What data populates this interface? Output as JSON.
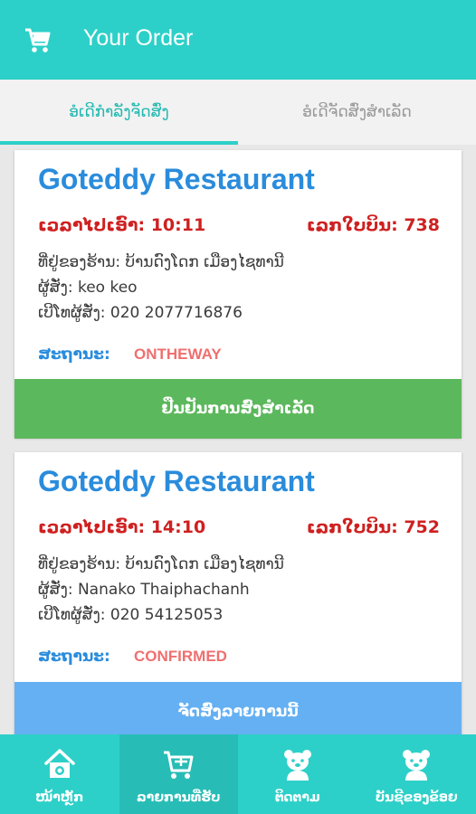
{
  "header": {
    "title": "Your Order",
    "icon": "cart-icon"
  },
  "tabs": [
    {
      "label": "ອໍເດີກຳລັງຈັດສົ່ງ",
      "active": true
    },
    {
      "label": "ອໍເດີຈັດສົ່ງສຳເລັດ",
      "active": false
    }
  ],
  "orders": [
    {
      "restaurant": "Goteddy Restaurant",
      "time": "ເວລາໄປເອົາ: 10:11",
      "bill": "ເລກໃບບິນ: 738",
      "address": "ທີ່ຢູ່ຂອງຮ້ານ: ບ້ານດົງໂດກ ເມືອງໄຊທານີ",
      "orderer": "ຜູ້ສັ່ງ: keo keo",
      "phone": "ເບີໂທຜູ້ສັ່ງ: 020 2077716876",
      "status_label": "ສະຖານະ:",
      "status": "ONTHEWAY",
      "action": "ຢືນຢັນການສົ່ງສຳເລັດ",
      "action_color": "#5cb85c"
    },
    {
      "restaurant": "Goteddy Restaurant",
      "time": "ເວລາໄປເອົາ: 14:10",
      "bill": "ເລກໃບບິນ: 752",
      "address": "ທີ່ຢູ່ຂອງຮ້ານ: ບ້ານດົງໂດກ ເມືອງໄຊທານີ",
      "orderer": "ຜູ້ສັ່ງ: Nanako Thaiphachanh",
      "phone": "ເບີໂທຜູ້ສັ່ງ: 020 54125053",
      "status_label": "ສະຖານະ:",
      "status": "CONFIRMED",
      "action": "ຈັດສົ່ງລາຍການນີ້",
      "action_color": "#64b0f2"
    }
  ],
  "bottom_nav": [
    {
      "label": "ໜ້າຫຼັກ",
      "icon": "home-icon",
      "active": false
    },
    {
      "label": "ລາຍການທີ່ຮັບ",
      "icon": "cart-icon",
      "active": true
    },
    {
      "label": "ຕິດຕາມ",
      "icon": "teddy-icon",
      "active": false
    },
    {
      "label": "ບັນຊີຂອງຂ້ອຍ",
      "icon": "teddy-icon",
      "active": false
    }
  ],
  "colors": {
    "primary": "#2dd0c8",
    "restaurant": "#2a8cdc",
    "highlight": "#cf2020",
    "status": "#ef6f6f",
    "confirm": "#5cb85c",
    "deliver": "#64b0f2"
  }
}
